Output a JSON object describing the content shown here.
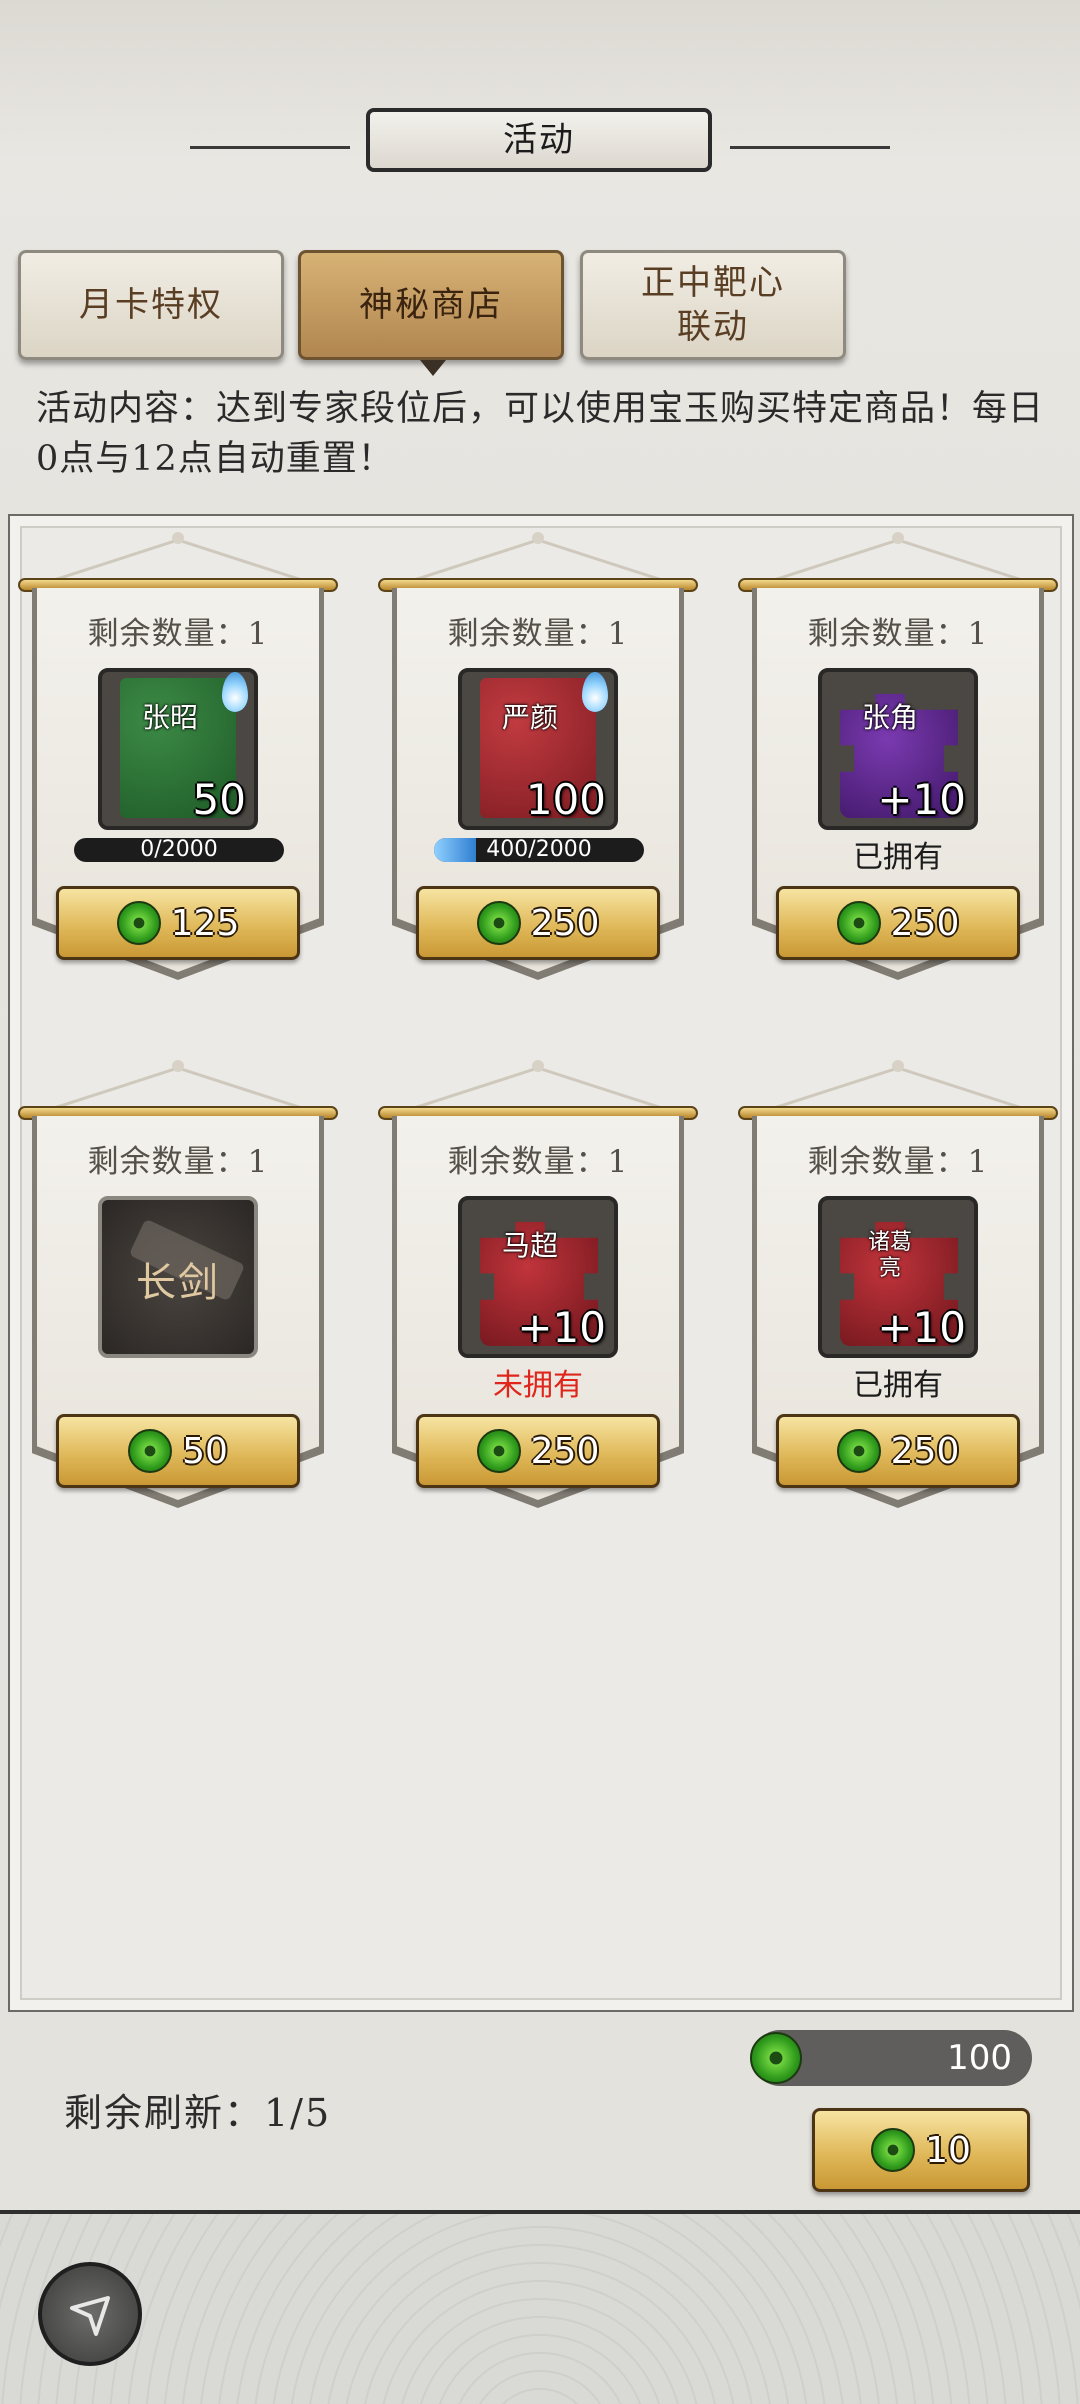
{
  "header": {
    "title": "活动"
  },
  "tabs": [
    {
      "label": "月卡特权",
      "active": false
    },
    {
      "label": "神秘商店",
      "active": true
    },
    {
      "label": "正中靶心\n联动",
      "active": false
    }
  ],
  "description": "活动内容：达到专家段位后，可以使用宝玉购买特定商品！每日0点与12点自动重置！",
  "items": [
    {
      "quantity": "剩余数量：1",
      "type": "card",
      "name": "张昭",
      "count": "50",
      "progress": "0/2000",
      "progress_fraction": 0,
      "price": "125"
    },
    {
      "quantity": "剩余数量：1",
      "type": "card",
      "name": "严颜",
      "count": "100",
      "progress": "400/2000",
      "progress_fraction": 0.2,
      "price": "250"
    },
    {
      "quantity": "剩余数量：1",
      "type": "fragment",
      "name": "张角",
      "count": "+10",
      "status": "已拥有",
      "price": "250"
    },
    {
      "quantity": "剩余数量：1",
      "type": "weapon",
      "name": "长剑",
      "price": "50"
    },
    {
      "quantity": "剩余数量：1",
      "type": "fragment",
      "name": "马超",
      "count": "+10",
      "status": "未拥有",
      "price": "250"
    },
    {
      "quantity": "剩余数量：1",
      "type": "fragment",
      "name": "诸葛亮",
      "count": "+10",
      "status": "已拥有",
      "price": "250"
    }
  ],
  "footer": {
    "refresh_label": "剩余刷新：1/5",
    "balance": "100",
    "refresh_cost": "10"
  },
  "colors": {
    "jade": "#2f9b1c",
    "gold_button": "#e0b95a",
    "active_tab": "#c49a5f",
    "not_owned": "#e0261c"
  }
}
